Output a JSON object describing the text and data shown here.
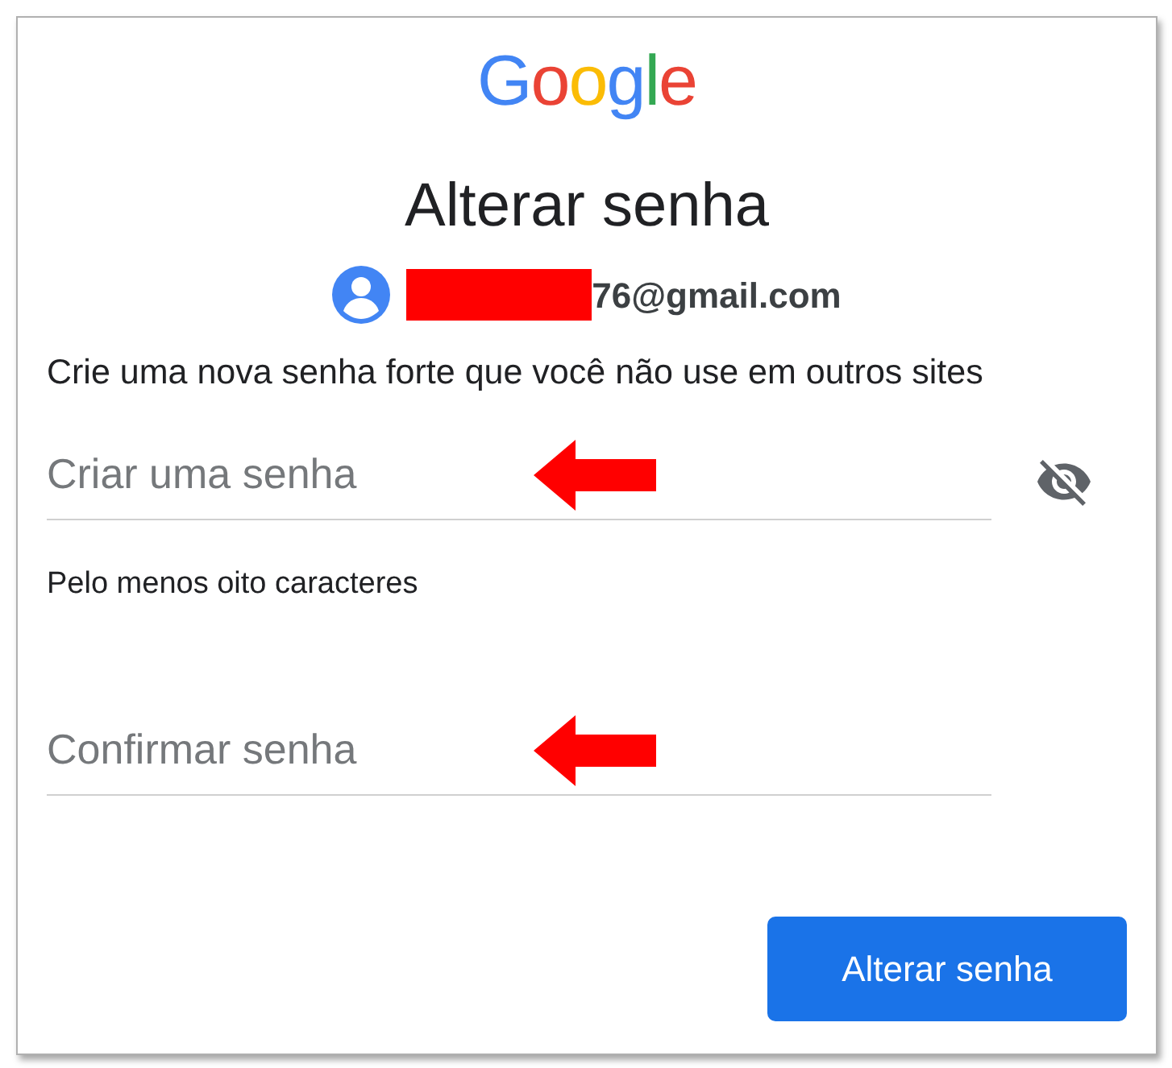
{
  "logo": {
    "text": "Google"
  },
  "title": "Alterar senha",
  "account": {
    "email": "76@gmail.com",
    "redacted": true
  },
  "description": "Crie uma nova senha forte que você não use em outros sites",
  "fields": [
    {
      "placeholder": "Criar uma senha",
      "arrow": true,
      "show_toggle": true,
      "helper": "Pelo menos oito caracteres"
    },
    {
      "placeholder": "Confirmar senha",
      "arrow": true,
      "show_toggle": false
    }
  ],
  "button": {
    "label": "Alterar senha"
  }
}
